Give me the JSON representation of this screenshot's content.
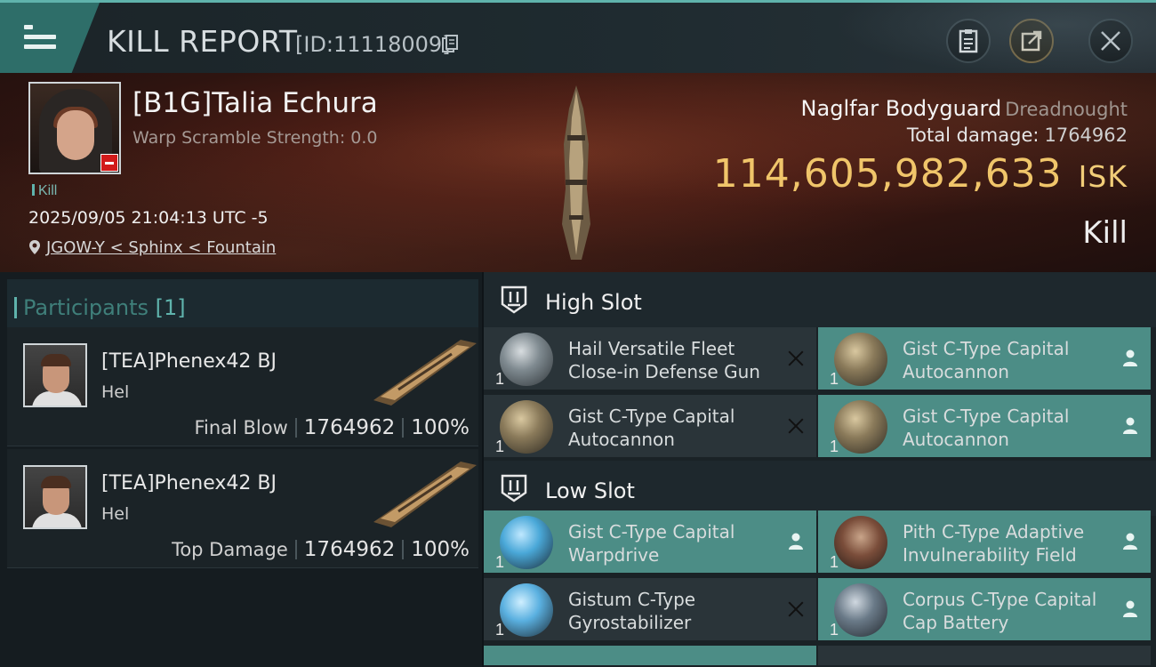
{
  "titlebar": {
    "title": "KILL REPORT",
    "id": "[ID:11118009]"
  },
  "victim": {
    "name": "[B1G]Talia Echura",
    "warp_scramble": "Warp Scramble Strength: 0.0",
    "kill_tag": "Kill",
    "datetime": "2025/09/05 21:04:13 UTC -5",
    "location": "JGOW-Y < Sphinx < Fountain",
    "ship_name": "Naglfar Bodyguard",
    "ship_class": "Dreadnought",
    "total_damage_label": "Total damage:",
    "total_damage": "1764962",
    "isk_value": "114,605,982,633",
    "isk_unit": "ISK",
    "result": "Kill"
  },
  "participants": {
    "label": "Participants",
    "count": "[1]",
    "rows": [
      {
        "name": "[TEA]Phenex42 BJ",
        "ship": "Hel",
        "role": "Final Blow",
        "damage": "1764962",
        "percent": "100%"
      },
      {
        "name": "[TEA]Phenex42 BJ",
        "ship": "Hel",
        "role": "Top Damage",
        "damage": "1764962",
        "percent": "100%"
      }
    ]
  },
  "high_slot": {
    "label": "High Slot",
    "modules": [
      {
        "name": "Hail Versatile Fleet Close-in Defense Gun",
        "qty": "1",
        "status": "destroyed"
      },
      {
        "name": "Gist C-Type Capital Autocannon",
        "qty": "1",
        "status": "dropped"
      },
      {
        "name": "Gist C-Type Capital Autocannon",
        "qty": "1",
        "status": "destroyed"
      },
      {
        "name": "Gist C-Type Capital Autocannon",
        "qty": "1",
        "status": "dropped"
      }
    ]
  },
  "low_slot": {
    "label": "Low Slot",
    "modules": [
      {
        "name": "Gist C-Type Capital Warpdrive",
        "qty": "1",
        "status": "dropped"
      },
      {
        "name": "Pith C-Type Adaptive Invulnerability Field",
        "qty": "1",
        "status": "dropped"
      },
      {
        "name": "Gistum C-Type Gyrostabilizer",
        "qty": "1",
        "status": "destroyed"
      },
      {
        "name": "Corpus C-Type Capital Cap Battery",
        "qty": "1",
        "status": "dropped"
      }
    ]
  },
  "colors": {
    "accent_teal": "#5fb3ac",
    "dropped_bg": "#4c8d86",
    "isk_gold": "#f0c56a",
    "destroyed_bg": "#2a3439"
  }
}
